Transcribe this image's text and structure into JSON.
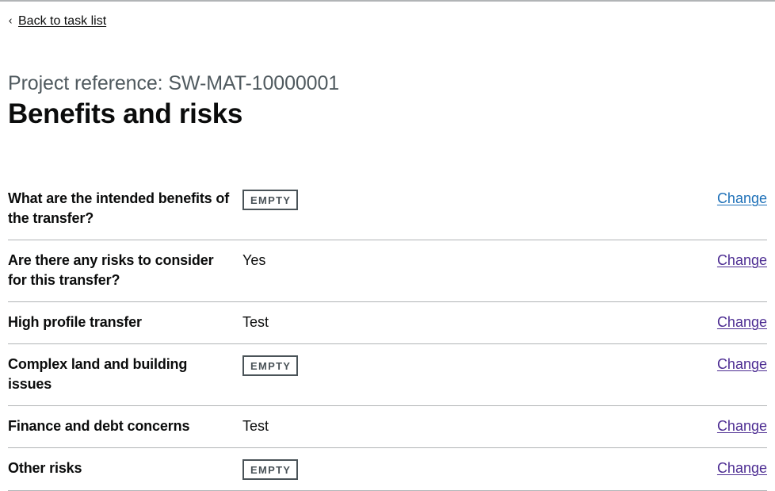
{
  "back_link": {
    "label": "Back to task list",
    "chevron": "chevron-left-icon"
  },
  "header": {
    "caption": "Project reference: SW-MAT-10000001",
    "title": "Benefits and risks"
  },
  "colors": {
    "link": "#1d70b8",
    "link_visited": "#4c2c92",
    "caption_grey": "#505a5f",
    "border_grey": "#b1b4b6",
    "tag_grey": "#4a5358",
    "text": "#0b0c0c"
  },
  "summary_list": {
    "change_label": "Change",
    "empty_tag_label": "EMPTY",
    "rows": [
      {
        "key": "What are the intended benefits of the transfer?",
        "value": "",
        "is_empty": true,
        "action": "Change",
        "visited": false
      },
      {
        "key": "Are there any risks to consider for this transfer?",
        "value": "Yes",
        "is_empty": false,
        "action": "Change",
        "visited": true
      },
      {
        "key": "High profile transfer",
        "value": "Test",
        "is_empty": false,
        "action": "Change",
        "visited": true
      },
      {
        "key": "Complex land and building issues",
        "value": "",
        "is_empty": true,
        "action": "Change",
        "visited": true
      },
      {
        "key": "Finance and debt concerns",
        "value": "Test",
        "is_empty": false,
        "action": "Change",
        "visited": true
      },
      {
        "key": "Other risks",
        "value": "",
        "is_empty": true,
        "action": "Change",
        "visited": true
      }
    ]
  }
}
